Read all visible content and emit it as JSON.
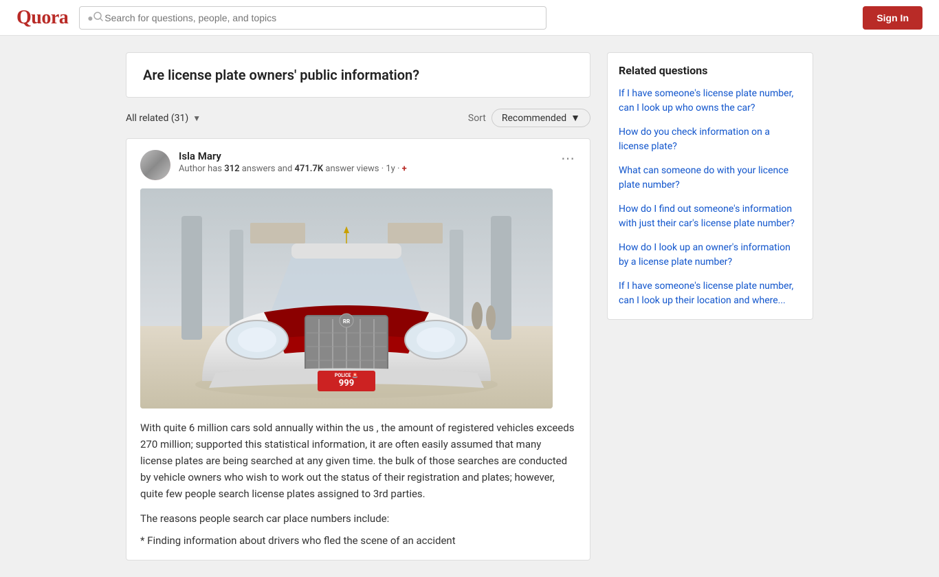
{
  "header": {
    "logo": "Quora",
    "search_placeholder": "Search for questions, people, and topics",
    "sign_in_label": "Sign In"
  },
  "question": {
    "title": "Are license plate owners' public information?"
  },
  "answers_bar": {
    "all_related_label": "All related (31)",
    "sort_label": "Sort",
    "sort_value": "Recommended"
  },
  "author": {
    "name": "Isla Mary",
    "meta_prefix": "Author has",
    "answers_count": "312",
    "answers_label": "answers and",
    "views_count": "471.7K",
    "views_label": "answer views",
    "time_label": "1y"
  },
  "license_plate": {
    "top_text": "POLICE",
    "number": "999"
  },
  "answer": {
    "paragraph1": "With quite 6 million cars sold annually within the us , the amount of registered vehicles exceeds 270 million; supported this statistical information, it are often easily assumed that many license plates are being searched at any given time. the bulk of those searches are conducted by vehicle owners who wish to work out the status of their registration and plates; however, quite few people search license plates assigned to 3rd parties.",
    "paragraph2": "The reasons people search car place numbers include:",
    "paragraph3": "* Finding information about drivers who fled the scene of an accident"
  },
  "related": {
    "title": "Related questions",
    "items": [
      "If I have someone's license plate number, can I look up who owns the car?",
      "How do you check information on a license plate?",
      "What can someone do with your licence plate number?",
      "How do I find out someone's information with just their car's license plate number?",
      "How do I look up an owner's information by a license plate number?",
      "If I have someone's license plate number, can I look up their location and where..."
    ]
  }
}
